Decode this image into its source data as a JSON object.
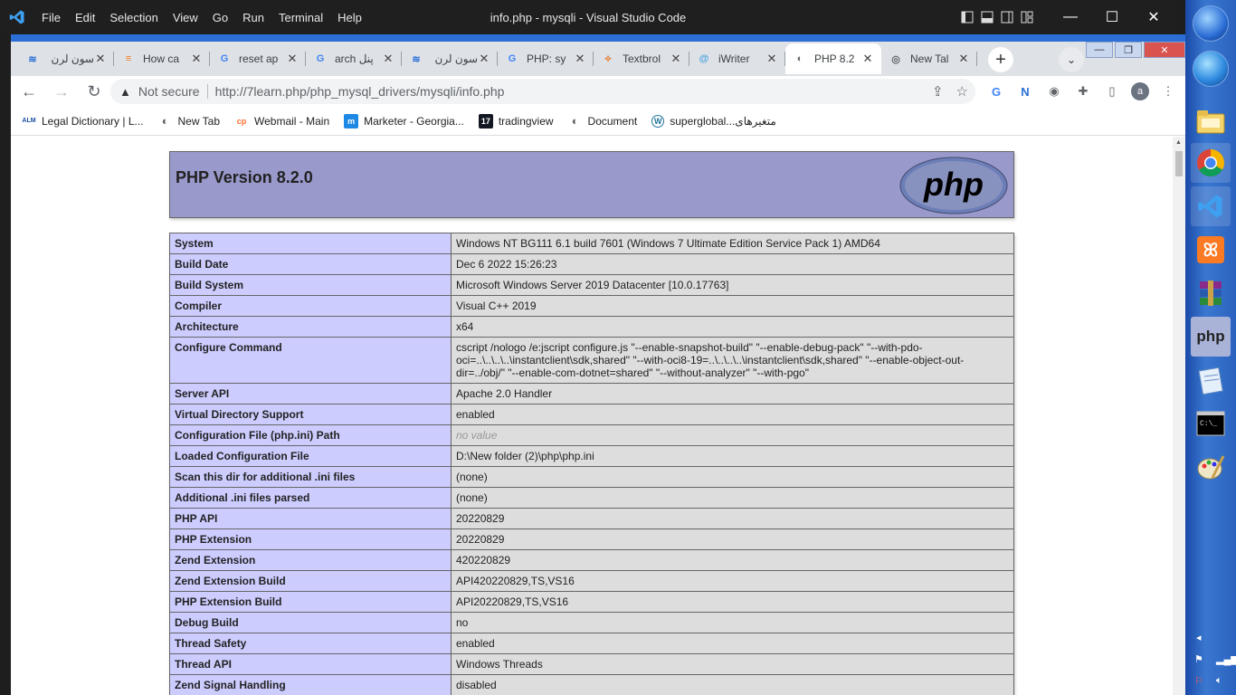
{
  "vscode": {
    "menu": [
      "File",
      "Edit",
      "Selection",
      "View",
      "Go",
      "Run",
      "Terminal",
      "Help"
    ],
    "title": "info.php - mysqli - Visual Studio Code",
    "min": "—",
    "max": "☐",
    "close": "✕"
  },
  "tabs": [
    {
      "title": "سون لرن",
      "close": "✕"
    },
    {
      "title": "How ca",
      "close": "✕"
    },
    {
      "title": "reset ap",
      "close": "✕"
    },
    {
      "title": "arch پنل",
      "close": "✕"
    },
    {
      "title": "سون لرن",
      "close": "✕"
    },
    {
      "title": "PHP: sy",
      "close": "✕"
    },
    {
      "title": "Textbrol",
      "close": "✕"
    },
    {
      "title": "iWriter",
      "close": "✕"
    },
    {
      "title": "PHP 8.2",
      "close": "✕"
    },
    {
      "title": "New Tal",
      "close": "✕"
    }
  ],
  "new_tab": "+",
  "tab_search": "⌄",
  "chrome_ctrls": {
    "min": "—",
    "max": "❐",
    "close": "✕"
  },
  "toolbar": {
    "back": "←",
    "forward": "→",
    "reload": "↻",
    "warn": "▲",
    "not_secure": "Not secure",
    "url": "http://7learn.php/php_mysql_drivers/mysqli/info.php",
    "share": "⇪",
    "star": "☆",
    "avatar": "a"
  },
  "bookmarks": [
    {
      "icon": "ALM",
      "label": "Legal Dictionary | L..."
    },
    {
      "icon": "◐",
      "label": "New Tab"
    },
    {
      "icon": "cp",
      "label": "Webmail - Main"
    },
    {
      "icon": "m",
      "label": "Marketer - Georgia..."
    },
    {
      "icon": "17",
      "label": "tradingview"
    },
    {
      "icon": "◐",
      "label": "Document"
    },
    {
      "icon": "W",
      "label": "superglobal...متغیرهای"
    }
  ],
  "php": {
    "version_title": "PHP Version 8.2.0",
    "logo_text": "php",
    "rows": [
      {
        "k": "System",
        "v": "Windows NT BG111 6.1 build 7601 (Windows 7 Ultimate Edition Service Pack 1) AMD64"
      },
      {
        "k": "Build Date",
        "v": "Dec 6 2022 15:26:23"
      },
      {
        "k": "Build System",
        "v": "Microsoft Windows Server 2019 Datacenter [10.0.17763]"
      },
      {
        "k": "Compiler",
        "v": "Visual C++ 2019"
      },
      {
        "k": "Architecture",
        "v": "x64"
      },
      {
        "k": "Configure Command",
        "v": "cscript /nologo /e:jscript configure.js \"--enable-snapshot-build\" \"--enable-debug-pack\" \"--with-pdo-oci=..\\..\\..\\..\\instantclient\\sdk,shared\" \"--with-oci8-19=..\\..\\..\\..\\instantclient\\sdk,shared\" \"--enable-object-out-dir=../obj/\" \"--enable-com-dotnet=shared\" \"--without-analyzer\" \"--with-pgo\""
      },
      {
        "k": "Server API",
        "v": "Apache 2.0 Handler"
      },
      {
        "k": "Virtual Directory Support",
        "v": "enabled"
      },
      {
        "k": "Configuration File (php.ini) Path",
        "v": "no value"
      },
      {
        "k": "Loaded Configuration File",
        "v": "D:\\New folder (2)\\php\\php.ini"
      },
      {
        "k": "Scan this dir for additional .ini files",
        "v": "(none)"
      },
      {
        "k": "Additional .ini files parsed",
        "v": "(none)"
      },
      {
        "k": "PHP API",
        "v": "20220829"
      },
      {
        "k": "PHP Extension",
        "v": "20220829"
      },
      {
        "k": "Zend Extension",
        "v": "420220829"
      },
      {
        "k": "Zend Extension Build",
        "v": "API420220829,TS,VS16"
      },
      {
        "k": "PHP Extension Build",
        "v": "API20220829,TS,VS16"
      },
      {
        "k": "Debug Build",
        "v": "no"
      },
      {
        "k": "Thread Safety",
        "v": "enabled"
      },
      {
        "k": "Thread API",
        "v": "Windows Threads"
      },
      {
        "k": "Zend Signal Handling",
        "v": "disabled"
      }
    ]
  },
  "taskbar": {
    "apps": [
      "ie-icon",
      "file-explorer-icon",
      "chrome-icon",
      "vscode-icon",
      "xampp-icon",
      "winrar-icon",
      "php-icon",
      "notepad-icon",
      "cmd-icon",
      "paint-icon"
    ],
    "cmd_text": "C:\\_",
    "php_text": "php",
    "tray_arrow": "◂"
  }
}
